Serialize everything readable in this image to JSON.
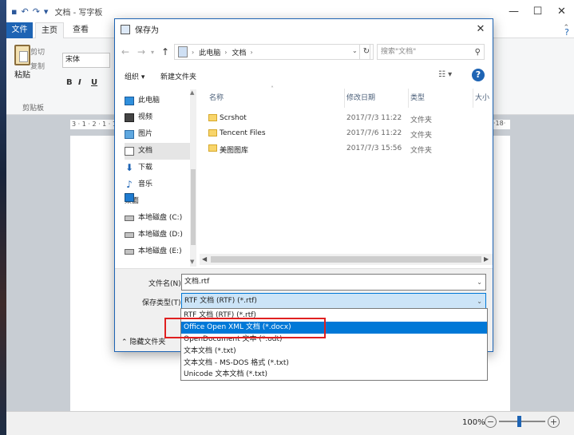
{
  "wordpad": {
    "title": "文档 - 写字板",
    "tabs": {
      "file": "文件",
      "home": "主页",
      "view": "查看"
    },
    "paste_label": "粘贴",
    "clipboard": {
      "cut": "剪切",
      "copy": "复制",
      "group": "剪贴板"
    },
    "font_name": "宋体",
    "format_buttons": [
      "B",
      "I",
      "U"
    ],
    "ruler": "3 · 1 · 2 · 1 · 1 ·",
    "ruler_end": "·18·",
    "zoom": "100%"
  },
  "dialog": {
    "title": "保存为",
    "close": "✕",
    "address": [
      "此电脑",
      "文档"
    ],
    "search_placeholder": "搜索\"文档\"",
    "toolbar": {
      "organize": "组织 ▾",
      "new_folder": "新建文件夹"
    },
    "help": "?",
    "nav": [
      {
        "label": "此电脑",
        "icon": "pc"
      },
      {
        "label": "视频",
        "icon": "video"
      },
      {
        "label": "图片",
        "icon": "pic"
      },
      {
        "label": "文档",
        "icon": "doc",
        "selected": true
      },
      {
        "label": "下载",
        "icon": "dl"
      },
      {
        "label": "音乐",
        "icon": "music"
      },
      {
        "label": "桌面",
        "icon": "desk"
      },
      {
        "label": "本地磁盘 (C:)",
        "icon": "drive"
      },
      {
        "label": "本地磁盘 (D:)",
        "icon": "drive"
      },
      {
        "label": "本地磁盘 (E:)",
        "icon": "drive"
      }
    ],
    "columns": {
      "name": "名称",
      "date": "修改日期",
      "type": "类型",
      "size": "大小"
    },
    "files": [
      {
        "name": "Scrshot",
        "date": "2017/7/3 11:22",
        "type": "文件夹"
      },
      {
        "name": "Tencent Files",
        "date": "2017/7/6 11:22",
        "type": "文件夹"
      },
      {
        "name": "美图图库",
        "date": "2017/7/3 15:56",
        "type": "文件夹"
      }
    ],
    "filename_label": "文件名(N):",
    "filename_value": "文档.rtf",
    "type_label": "保存类型(T):",
    "type_value": "RTF 文档 (RTF) (*.rtf)",
    "hide_folders": "隐藏文件夹",
    "type_options": [
      "RTF 文档 (RTF) (*.rtf)",
      "Office Open XML 文档 (*.docx)",
      "OpenDocument 文本 (*.odt)",
      "文本文档 (*.txt)",
      "文本文档 - MS-DOS 格式 (*.txt)",
      "Unicode 文本文档 (*.txt)"
    ],
    "highlighted_option": 1
  },
  "colors": {
    "accent": "#0078d7",
    "file_tab": "#1e64b4",
    "callout": "#e02020"
  }
}
